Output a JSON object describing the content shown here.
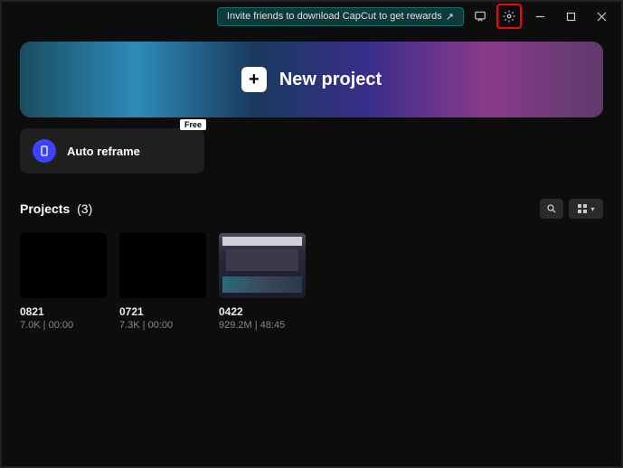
{
  "titlebar": {
    "invite_label": "Invite friends to download CapCut to get rewards"
  },
  "newProject": {
    "label": "New project"
  },
  "autoReframe": {
    "label": "Auto reframe",
    "badge": "Free"
  },
  "projectsHeader": {
    "title": "Projects",
    "count": "(3)"
  },
  "projects": [
    {
      "name": "0821",
      "meta": "7.0K | 00:00",
      "thumb": "blank"
    },
    {
      "name": "0721",
      "meta": "7.3K | 00:00",
      "thumb": "blank"
    },
    {
      "name": "0422",
      "meta": "929.2M | 48:45",
      "thumb": "editor"
    }
  ]
}
